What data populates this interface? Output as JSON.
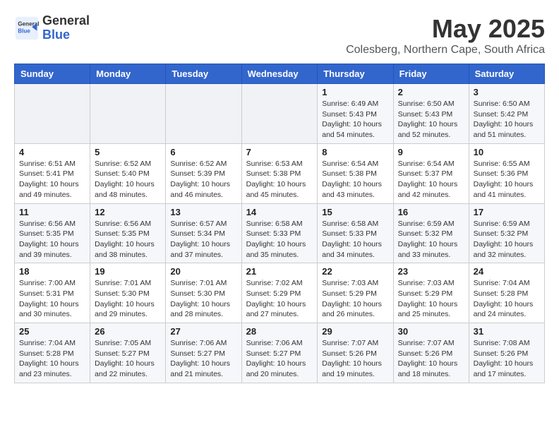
{
  "logo": {
    "text_general": "General",
    "text_blue": "Blue"
  },
  "title": "May 2025",
  "subtitle": "Colesberg, Northern Cape, South Africa",
  "days_of_week": [
    "Sunday",
    "Monday",
    "Tuesday",
    "Wednesday",
    "Thursday",
    "Friday",
    "Saturday"
  ],
  "weeks": [
    [
      {
        "day": "",
        "info": ""
      },
      {
        "day": "",
        "info": ""
      },
      {
        "day": "",
        "info": ""
      },
      {
        "day": "",
        "info": ""
      },
      {
        "day": "1",
        "info": "Sunrise: 6:49 AM\nSunset: 5:43 PM\nDaylight: 10 hours\nand 54 minutes."
      },
      {
        "day": "2",
        "info": "Sunrise: 6:50 AM\nSunset: 5:43 PM\nDaylight: 10 hours\nand 52 minutes."
      },
      {
        "day": "3",
        "info": "Sunrise: 6:50 AM\nSunset: 5:42 PM\nDaylight: 10 hours\nand 51 minutes."
      }
    ],
    [
      {
        "day": "4",
        "info": "Sunrise: 6:51 AM\nSunset: 5:41 PM\nDaylight: 10 hours\nand 49 minutes."
      },
      {
        "day": "5",
        "info": "Sunrise: 6:52 AM\nSunset: 5:40 PM\nDaylight: 10 hours\nand 48 minutes."
      },
      {
        "day": "6",
        "info": "Sunrise: 6:52 AM\nSunset: 5:39 PM\nDaylight: 10 hours\nand 46 minutes."
      },
      {
        "day": "7",
        "info": "Sunrise: 6:53 AM\nSunset: 5:38 PM\nDaylight: 10 hours\nand 45 minutes."
      },
      {
        "day": "8",
        "info": "Sunrise: 6:54 AM\nSunset: 5:38 PM\nDaylight: 10 hours\nand 43 minutes."
      },
      {
        "day": "9",
        "info": "Sunrise: 6:54 AM\nSunset: 5:37 PM\nDaylight: 10 hours\nand 42 minutes."
      },
      {
        "day": "10",
        "info": "Sunrise: 6:55 AM\nSunset: 5:36 PM\nDaylight: 10 hours\nand 41 minutes."
      }
    ],
    [
      {
        "day": "11",
        "info": "Sunrise: 6:56 AM\nSunset: 5:35 PM\nDaylight: 10 hours\nand 39 minutes."
      },
      {
        "day": "12",
        "info": "Sunrise: 6:56 AM\nSunset: 5:35 PM\nDaylight: 10 hours\nand 38 minutes."
      },
      {
        "day": "13",
        "info": "Sunrise: 6:57 AM\nSunset: 5:34 PM\nDaylight: 10 hours\nand 37 minutes."
      },
      {
        "day": "14",
        "info": "Sunrise: 6:58 AM\nSunset: 5:33 PM\nDaylight: 10 hours\nand 35 minutes."
      },
      {
        "day": "15",
        "info": "Sunrise: 6:58 AM\nSunset: 5:33 PM\nDaylight: 10 hours\nand 34 minutes."
      },
      {
        "day": "16",
        "info": "Sunrise: 6:59 AM\nSunset: 5:32 PM\nDaylight: 10 hours\nand 33 minutes."
      },
      {
        "day": "17",
        "info": "Sunrise: 6:59 AM\nSunset: 5:32 PM\nDaylight: 10 hours\nand 32 minutes."
      }
    ],
    [
      {
        "day": "18",
        "info": "Sunrise: 7:00 AM\nSunset: 5:31 PM\nDaylight: 10 hours\nand 30 minutes."
      },
      {
        "day": "19",
        "info": "Sunrise: 7:01 AM\nSunset: 5:30 PM\nDaylight: 10 hours\nand 29 minutes."
      },
      {
        "day": "20",
        "info": "Sunrise: 7:01 AM\nSunset: 5:30 PM\nDaylight: 10 hours\nand 28 minutes."
      },
      {
        "day": "21",
        "info": "Sunrise: 7:02 AM\nSunset: 5:29 PM\nDaylight: 10 hours\nand 27 minutes."
      },
      {
        "day": "22",
        "info": "Sunrise: 7:03 AM\nSunset: 5:29 PM\nDaylight: 10 hours\nand 26 minutes."
      },
      {
        "day": "23",
        "info": "Sunrise: 7:03 AM\nSunset: 5:29 PM\nDaylight: 10 hours\nand 25 minutes."
      },
      {
        "day": "24",
        "info": "Sunrise: 7:04 AM\nSunset: 5:28 PM\nDaylight: 10 hours\nand 24 minutes."
      }
    ],
    [
      {
        "day": "25",
        "info": "Sunrise: 7:04 AM\nSunset: 5:28 PM\nDaylight: 10 hours\nand 23 minutes."
      },
      {
        "day": "26",
        "info": "Sunrise: 7:05 AM\nSunset: 5:27 PM\nDaylight: 10 hours\nand 22 minutes."
      },
      {
        "day": "27",
        "info": "Sunrise: 7:06 AM\nSunset: 5:27 PM\nDaylight: 10 hours\nand 21 minutes."
      },
      {
        "day": "28",
        "info": "Sunrise: 7:06 AM\nSunset: 5:27 PM\nDaylight: 10 hours\nand 20 minutes."
      },
      {
        "day": "29",
        "info": "Sunrise: 7:07 AM\nSunset: 5:26 PM\nDaylight: 10 hours\nand 19 minutes."
      },
      {
        "day": "30",
        "info": "Sunrise: 7:07 AM\nSunset: 5:26 PM\nDaylight: 10 hours\nand 18 minutes."
      },
      {
        "day": "31",
        "info": "Sunrise: 7:08 AM\nSunset: 5:26 PM\nDaylight: 10 hours\nand 17 minutes."
      }
    ]
  ]
}
